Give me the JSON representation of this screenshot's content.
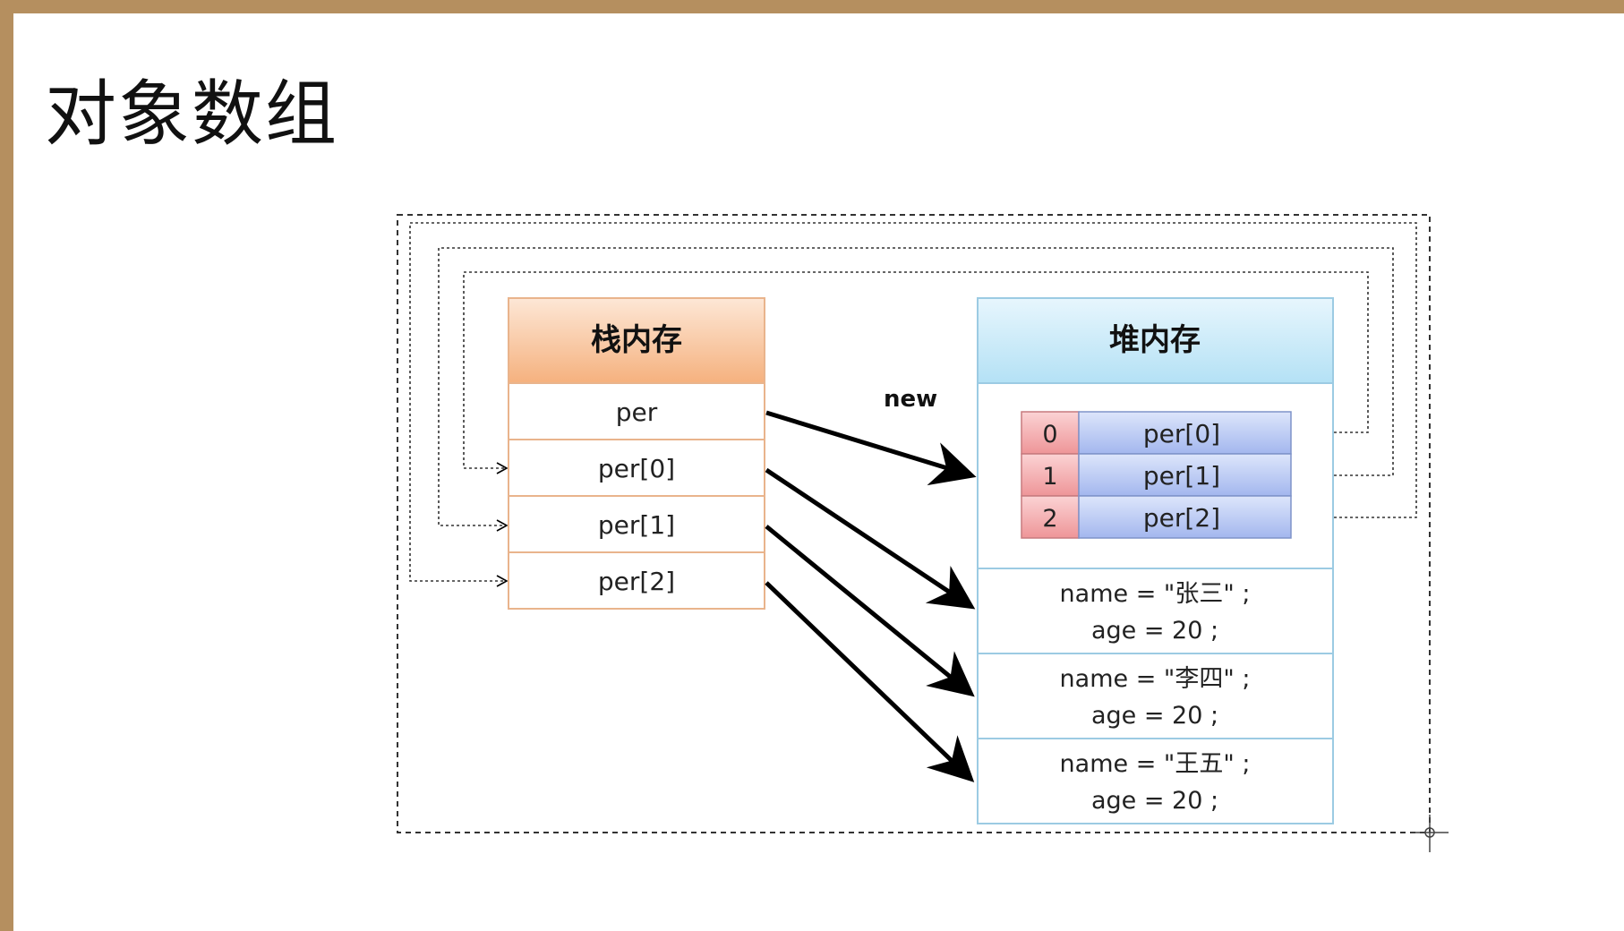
{
  "title": "对象数组",
  "stack": {
    "header": "栈内存",
    "cells": [
      "per",
      "per[0]",
      "per[1]",
      "per[2]"
    ]
  },
  "heap": {
    "header": "堆内存",
    "array": {
      "indices": [
        "0",
        "1",
        "2"
      ],
      "refs": [
        "per[0]",
        "per[1]",
        "per[2]"
      ]
    },
    "objects": [
      {
        "name": "name = \"张三\" ;",
        "age": "age = 20 ;"
      },
      {
        "name": "name = \"李四\" ;",
        "age": "age = 20 ;"
      },
      {
        "name": "name = \"王五\" ;",
        "age": "age = 20 ;"
      }
    ]
  },
  "arrow_label": "new",
  "colors": {
    "stack_header": "#f6b88a",
    "heap_header": "#bfe6f7",
    "index_cell": "#f3a3a6",
    "ref_cell": "#aebff0"
  }
}
